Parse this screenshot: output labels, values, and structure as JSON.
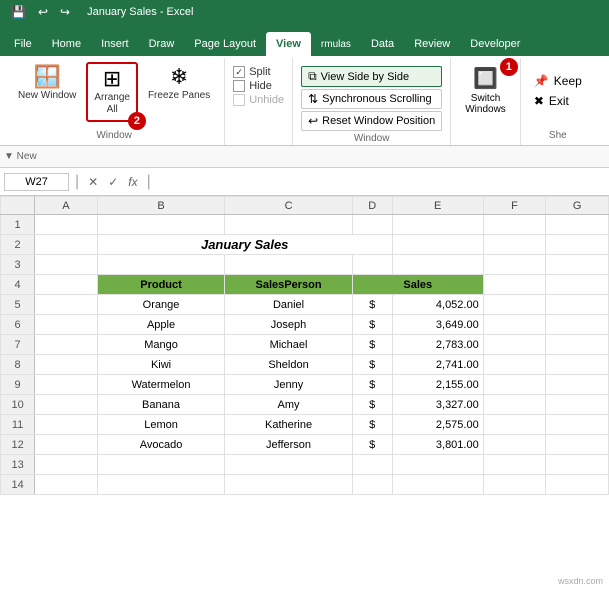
{
  "tabs": {
    "items": [
      "File",
      "Home",
      "Insert",
      "Draw",
      "Page Layout",
      "View",
      "rmulas",
      "Data",
      "Review",
      "Developer"
    ]
  },
  "quick_access": {
    "title": "January Sales - Excel"
  },
  "ribbon": {
    "window_group_label": "Window",
    "she_group_label": "She",
    "new_window_label": "New\nWindow",
    "arrange_all_label": "Arrange\nAll",
    "freeze_panes_label": "Freeze\nPanes",
    "split_label": "Split",
    "hide_label": "Hide",
    "unhide_label": "Unhide",
    "view_side_by_side_label": "View Side by Side",
    "synchronous_scrolling_label": "Synchronous Scrolling",
    "reset_window_position_label": "Reset Window Position",
    "switch_windows_label": "Switch\nWindows",
    "keep_label": "Keep",
    "exit_label": "Exit"
  },
  "formula_bar": {
    "name_box": "W27",
    "formula": ""
  },
  "sheet": {
    "title": "January Sales",
    "headers": [
      "Product",
      "SalesPerson",
      "Sales"
    ],
    "rows": [
      [
        "Orange",
        "Daniel",
        "$",
        "4,052.00"
      ],
      [
        "Apple",
        "Joseph",
        "$",
        "3,649.00"
      ],
      [
        "Mango",
        "Michael",
        "$",
        "2,783.00"
      ],
      [
        "Kiwi",
        "Sheldon",
        "$",
        "2,741.00"
      ],
      [
        "Watermelon",
        "Jenny",
        "$",
        "2,155.00"
      ],
      [
        "Banana",
        "Amy",
        "$",
        "3,327.00"
      ],
      [
        "Lemon",
        "Katherine",
        "$",
        "2,575.00"
      ],
      [
        "Avocado",
        "Jefferson",
        "$",
        "3,801.00"
      ]
    ]
  },
  "col_widths": [
    "30px",
    "60px",
    "110px",
    "110px",
    "40px",
    "80px",
    "60px",
    "60px"
  ],
  "circles": {
    "one": "1",
    "two": "2"
  },
  "watermark": "wsxdn.com"
}
